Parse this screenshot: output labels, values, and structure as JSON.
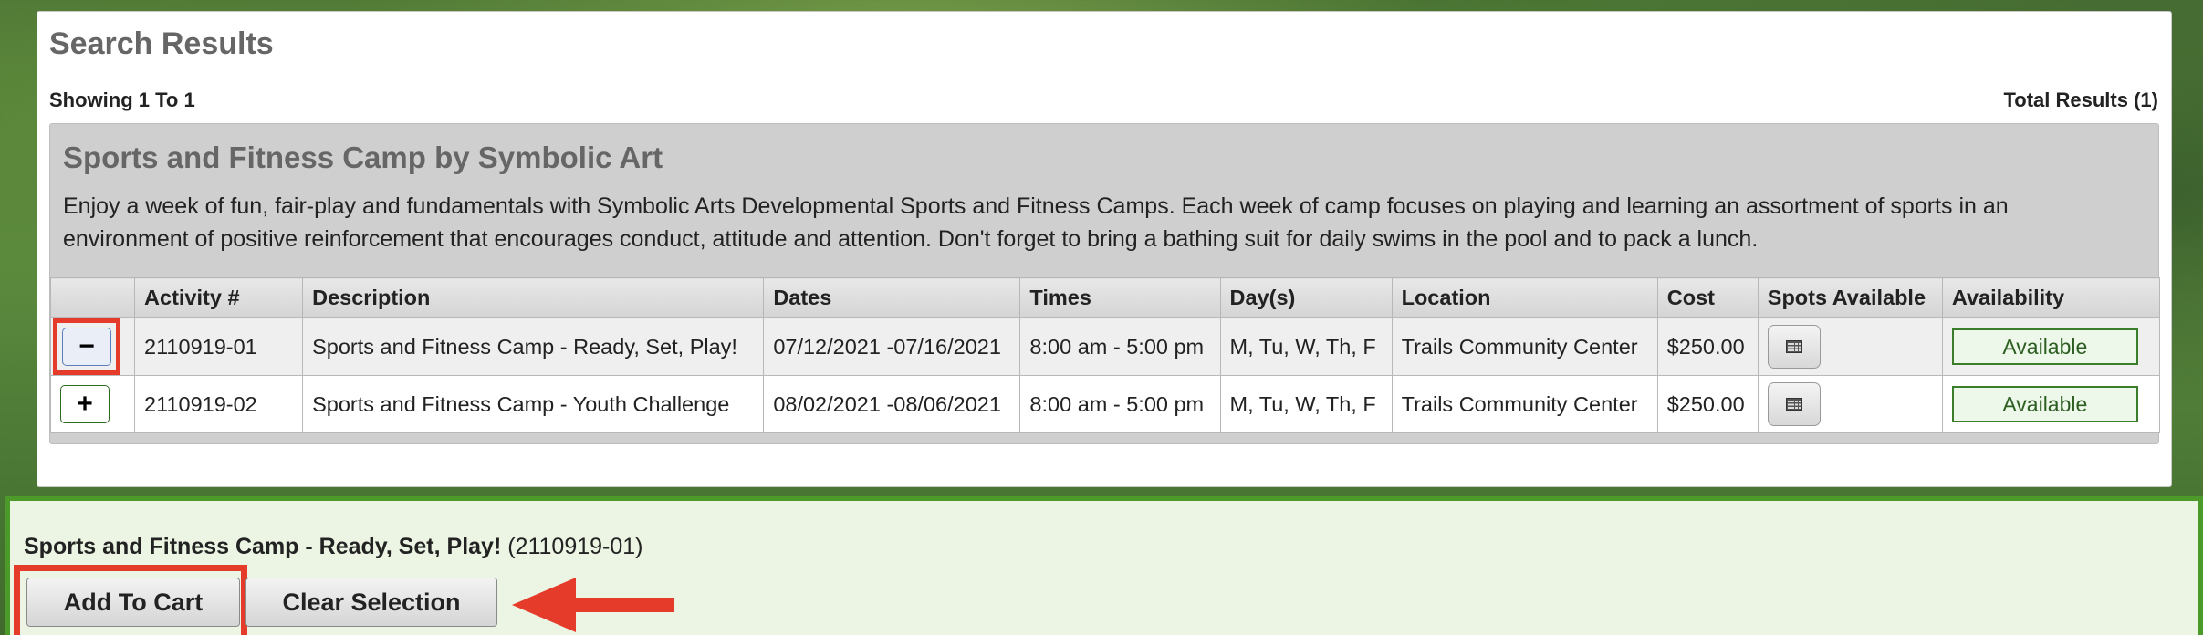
{
  "results": {
    "title": "Search Results",
    "showing": "Showing 1 To 1",
    "total": "Total Results (1)"
  },
  "program": {
    "title": "Sports and Fitness Camp by Symbolic Art",
    "description": "Enjoy a week of fun, fair-play and fundamentals with Symbolic Arts Developmental Sports and Fitness Camps. Each week of camp focuses on playing and learning an assortment of sports in an environment of positive reinforcement that encourages conduct, attitude and attention. Don't forget to bring a bathing suit for daily swims in the pool and to pack a lunch."
  },
  "table": {
    "headers": [
      "",
      "Activity #",
      "Description",
      "Dates",
      "Times",
      "Day(s)",
      "Location",
      "Cost",
      "Spots Available",
      "Availability"
    ],
    "rows": [
      {
        "toggle": "−",
        "activity": "2110919-01",
        "description": "Sports and Fitness Camp - Ready, Set, Play!",
        "dates": "07/12/2021 -07/16/2021",
        "times": "8:00 am - 5:00 pm",
        "days": "M, Tu, W, Th, F",
        "location": "Trails Community Center",
        "cost": "$250.00",
        "spots_icon": "calendar-grid-icon",
        "availability": "Available"
      },
      {
        "toggle": "+",
        "activity": "2110919-02",
        "description": "Sports and Fitness Camp - Youth Challenge",
        "dates": "08/02/2021 -08/06/2021",
        "times": "8:00 am - 5:00 pm",
        "days": "M, Tu, W, Th, F",
        "location": "Trails Community Center",
        "cost": "$250.00",
        "spots_icon": "calendar-grid-icon",
        "availability": "Available"
      }
    ]
  },
  "selection": {
    "name": "Sports and Fitness Camp - Ready, Set, Play!",
    "code": "(2110919-01)",
    "add_label": "Add To Cart",
    "clear_label": "Clear Selection"
  },
  "colors": {
    "highlight": "#e53b2b",
    "available_border": "#3a7d2a",
    "selection_border": "#4c9a2a"
  }
}
